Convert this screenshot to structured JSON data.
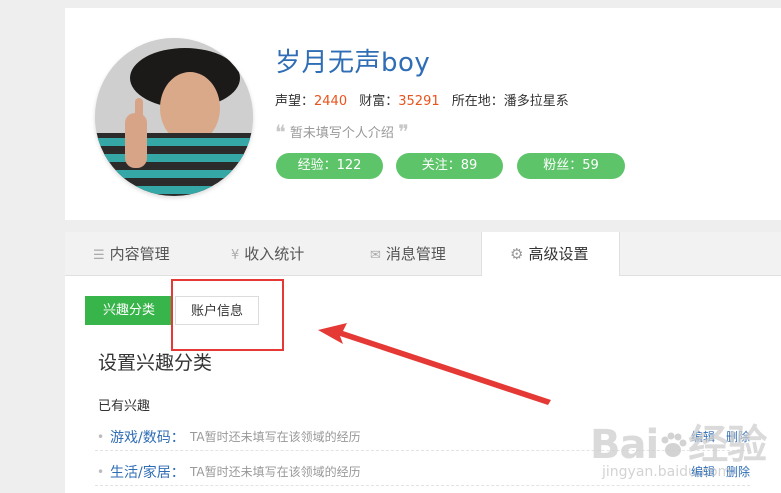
{
  "profile": {
    "username": "岁月无声boy",
    "reputation_label": "声望：",
    "reputation_value": "2440",
    "wealth_label": "财富：",
    "wealth_value": "35291",
    "location_label": "所在地：",
    "location_value": "潘多拉星系",
    "intro_open_quote": "❝",
    "intro": "暂未填写个人介绍",
    "intro_close_quote": "❞",
    "pills": {
      "experience": "经验：122",
      "follow": "关注：89",
      "fans": "粉丝：59"
    }
  },
  "tabs": [
    {
      "icon": "list-icon",
      "glyph": "☰",
      "label": "内容管理"
    },
    {
      "icon": "yen-icon",
      "glyph": "¥",
      "label": "收入统计"
    },
    {
      "icon": "envelope-icon",
      "glyph": "✉",
      "label": "消息管理"
    },
    {
      "icon": "gear-icon",
      "glyph": "⚙",
      "label": "高级设置"
    }
  ],
  "settings": {
    "subtabs": {
      "interest": "兴趣分类",
      "account": "账户信息"
    },
    "section_title": "设置兴趣分类",
    "existing_label": "已有兴趣",
    "interests": [
      {
        "bullet": "•",
        "category": "游戏/数码：",
        "desc": "TA暂时还未填写在该领域的经历",
        "edit": "编辑",
        "delete": "删除"
      },
      {
        "bullet": "•",
        "category": "生活/家居：",
        "desc": "TA暂时还未填写在该领域的经历",
        "edit": "编辑",
        "delete": "删除"
      }
    ]
  },
  "watermark": {
    "logo_left": "Bai",
    "logo_right": "经验",
    "url": "jingyan.baidu.com"
  },
  "colors": {
    "brand_blue": "#2f6db5",
    "accent_orange": "#e8541e",
    "pill_green": "#5ec46a",
    "subtab_green": "#38b54a",
    "annotation_red": "#e53935"
  }
}
